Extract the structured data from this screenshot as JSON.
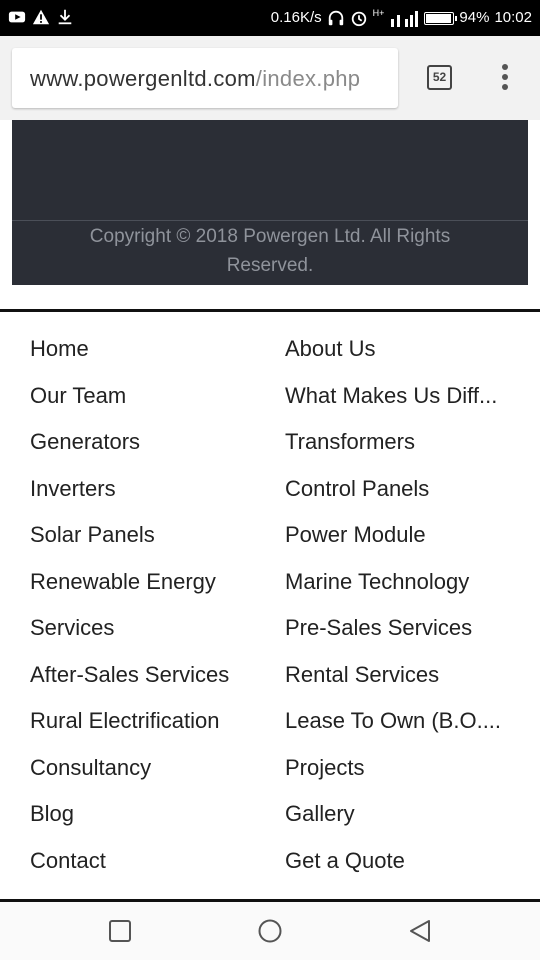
{
  "status_bar": {
    "net_speed": "0.16K/s",
    "network_label": "H+",
    "battery_pct": "94%",
    "battery_level": 0.94,
    "clock": "10:02",
    "icons": [
      "youtube-icon",
      "warning-icon",
      "download-icon",
      "headphones-icon",
      "alarm-icon",
      "signal-icon",
      "battery-icon"
    ]
  },
  "browser": {
    "url_host": "www.powergenltd.com",
    "url_path": "/index.php",
    "tab_count": "52"
  },
  "footer": {
    "copyright_line1": "Copyright © 2018 Powergen Ltd. All Rights",
    "copyright_line2": "Reserved."
  },
  "menu": {
    "left": [
      "Home",
      "Our Team",
      "Generators",
      "Inverters",
      "Solar Panels",
      "Renewable Energy",
      "Services",
      "After-Sales Services",
      "Rural Electrification",
      "Consultancy",
      "Blog",
      "Contact"
    ],
    "right": [
      "About Us",
      "What Makes Us Diff...",
      "Transformers",
      "Control Panels",
      "Power Module",
      "Marine Technology",
      "Pre-Sales Services",
      "Rental Services",
      "Lease To Own (B.O....",
      "Projects",
      "Gallery",
      "Get a Quote"
    ]
  },
  "colors": {
    "footer_bg": "#2b2e36",
    "copyright_text": "#8f939b",
    "menu_text": "#222222"
  }
}
